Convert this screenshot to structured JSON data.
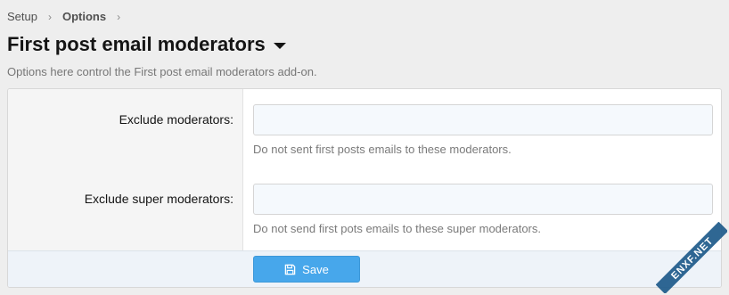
{
  "breadcrumb": {
    "items": [
      "Setup",
      "Options"
    ],
    "separator": "›"
  },
  "page": {
    "title": "First post email moderators",
    "description": "Options here control the First post email moderators add-on."
  },
  "fields": [
    {
      "label": "Exclude moderators:",
      "value": "",
      "hint": "Do not sent first posts emails to these moderators."
    },
    {
      "label": "Exclude super moderators:",
      "value": "",
      "hint": "Do not send first pots emails to these super moderators."
    }
  ],
  "footer": {
    "save_label": "Save",
    "save_icon": "save-icon"
  },
  "watermark": {
    "text": "ENXF.NET"
  },
  "colors": {
    "primary_button": "#47a7eb",
    "page_background": "#eeeeee",
    "footer_background": "#eef3f9",
    "watermark": "#1d5a8a"
  }
}
